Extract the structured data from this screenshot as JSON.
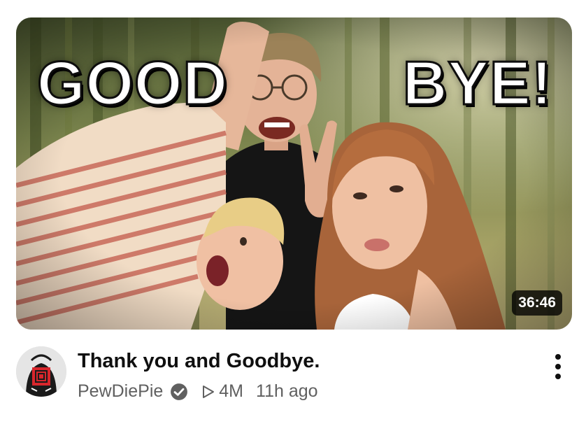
{
  "video": {
    "thumbnail_text_left": "GOOD",
    "thumbnail_text_right": "BYE!",
    "duration": "36:46",
    "title": "Thank you and Goodbye.",
    "channel": "PewDiePie",
    "views": "4M",
    "age": "11h ago"
  },
  "icons": {
    "verified": "check-circle-icon",
    "views": "play-outline-icon",
    "menu": "more-vertical-icon"
  },
  "colors": {
    "title": "#0f0f0f",
    "meta": "#606060",
    "duration_bg": "#000000"
  }
}
